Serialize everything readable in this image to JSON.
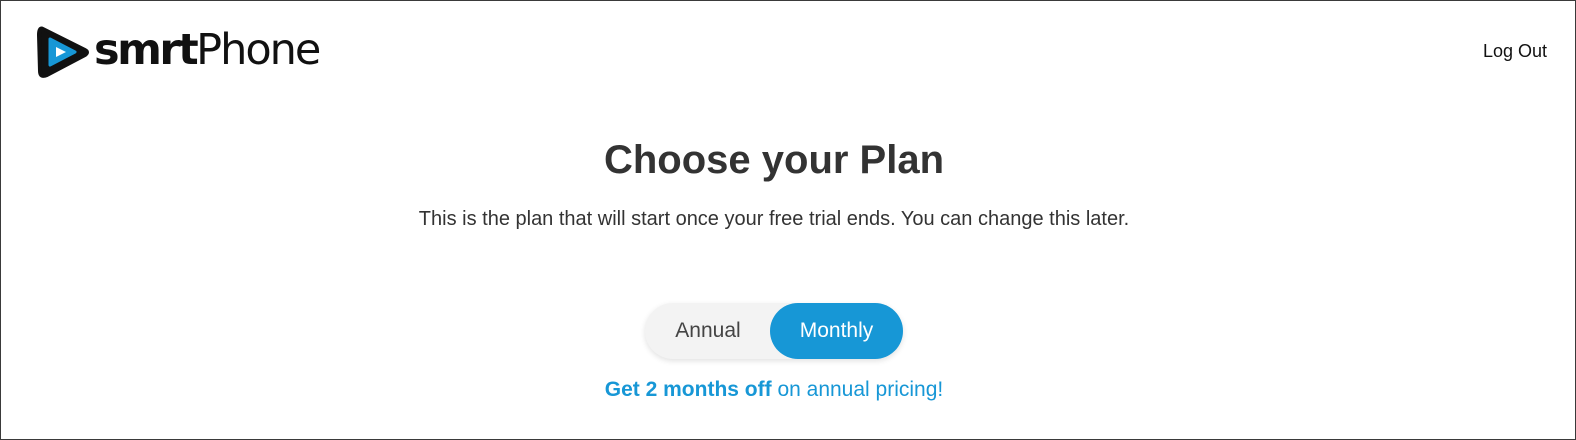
{
  "header": {
    "logo": {
      "text_bold": "smrt",
      "text_light": "Phone",
      "brand_dark": "#111111",
      "brand_blue": "#1797d6",
      "icon": "play-icon"
    },
    "logout_label": "Log Out"
  },
  "main": {
    "title": "Choose your Plan",
    "subtitle": "This is the plan that will start once your free trial ends. You can change this later.",
    "billing_toggle": {
      "options": [
        "Annual",
        "Monthly"
      ],
      "selected": "Monthly",
      "accent": "#1797d6"
    },
    "promo": {
      "highlight": "Get 2 months off",
      "rest": " on annual pricing!"
    }
  }
}
